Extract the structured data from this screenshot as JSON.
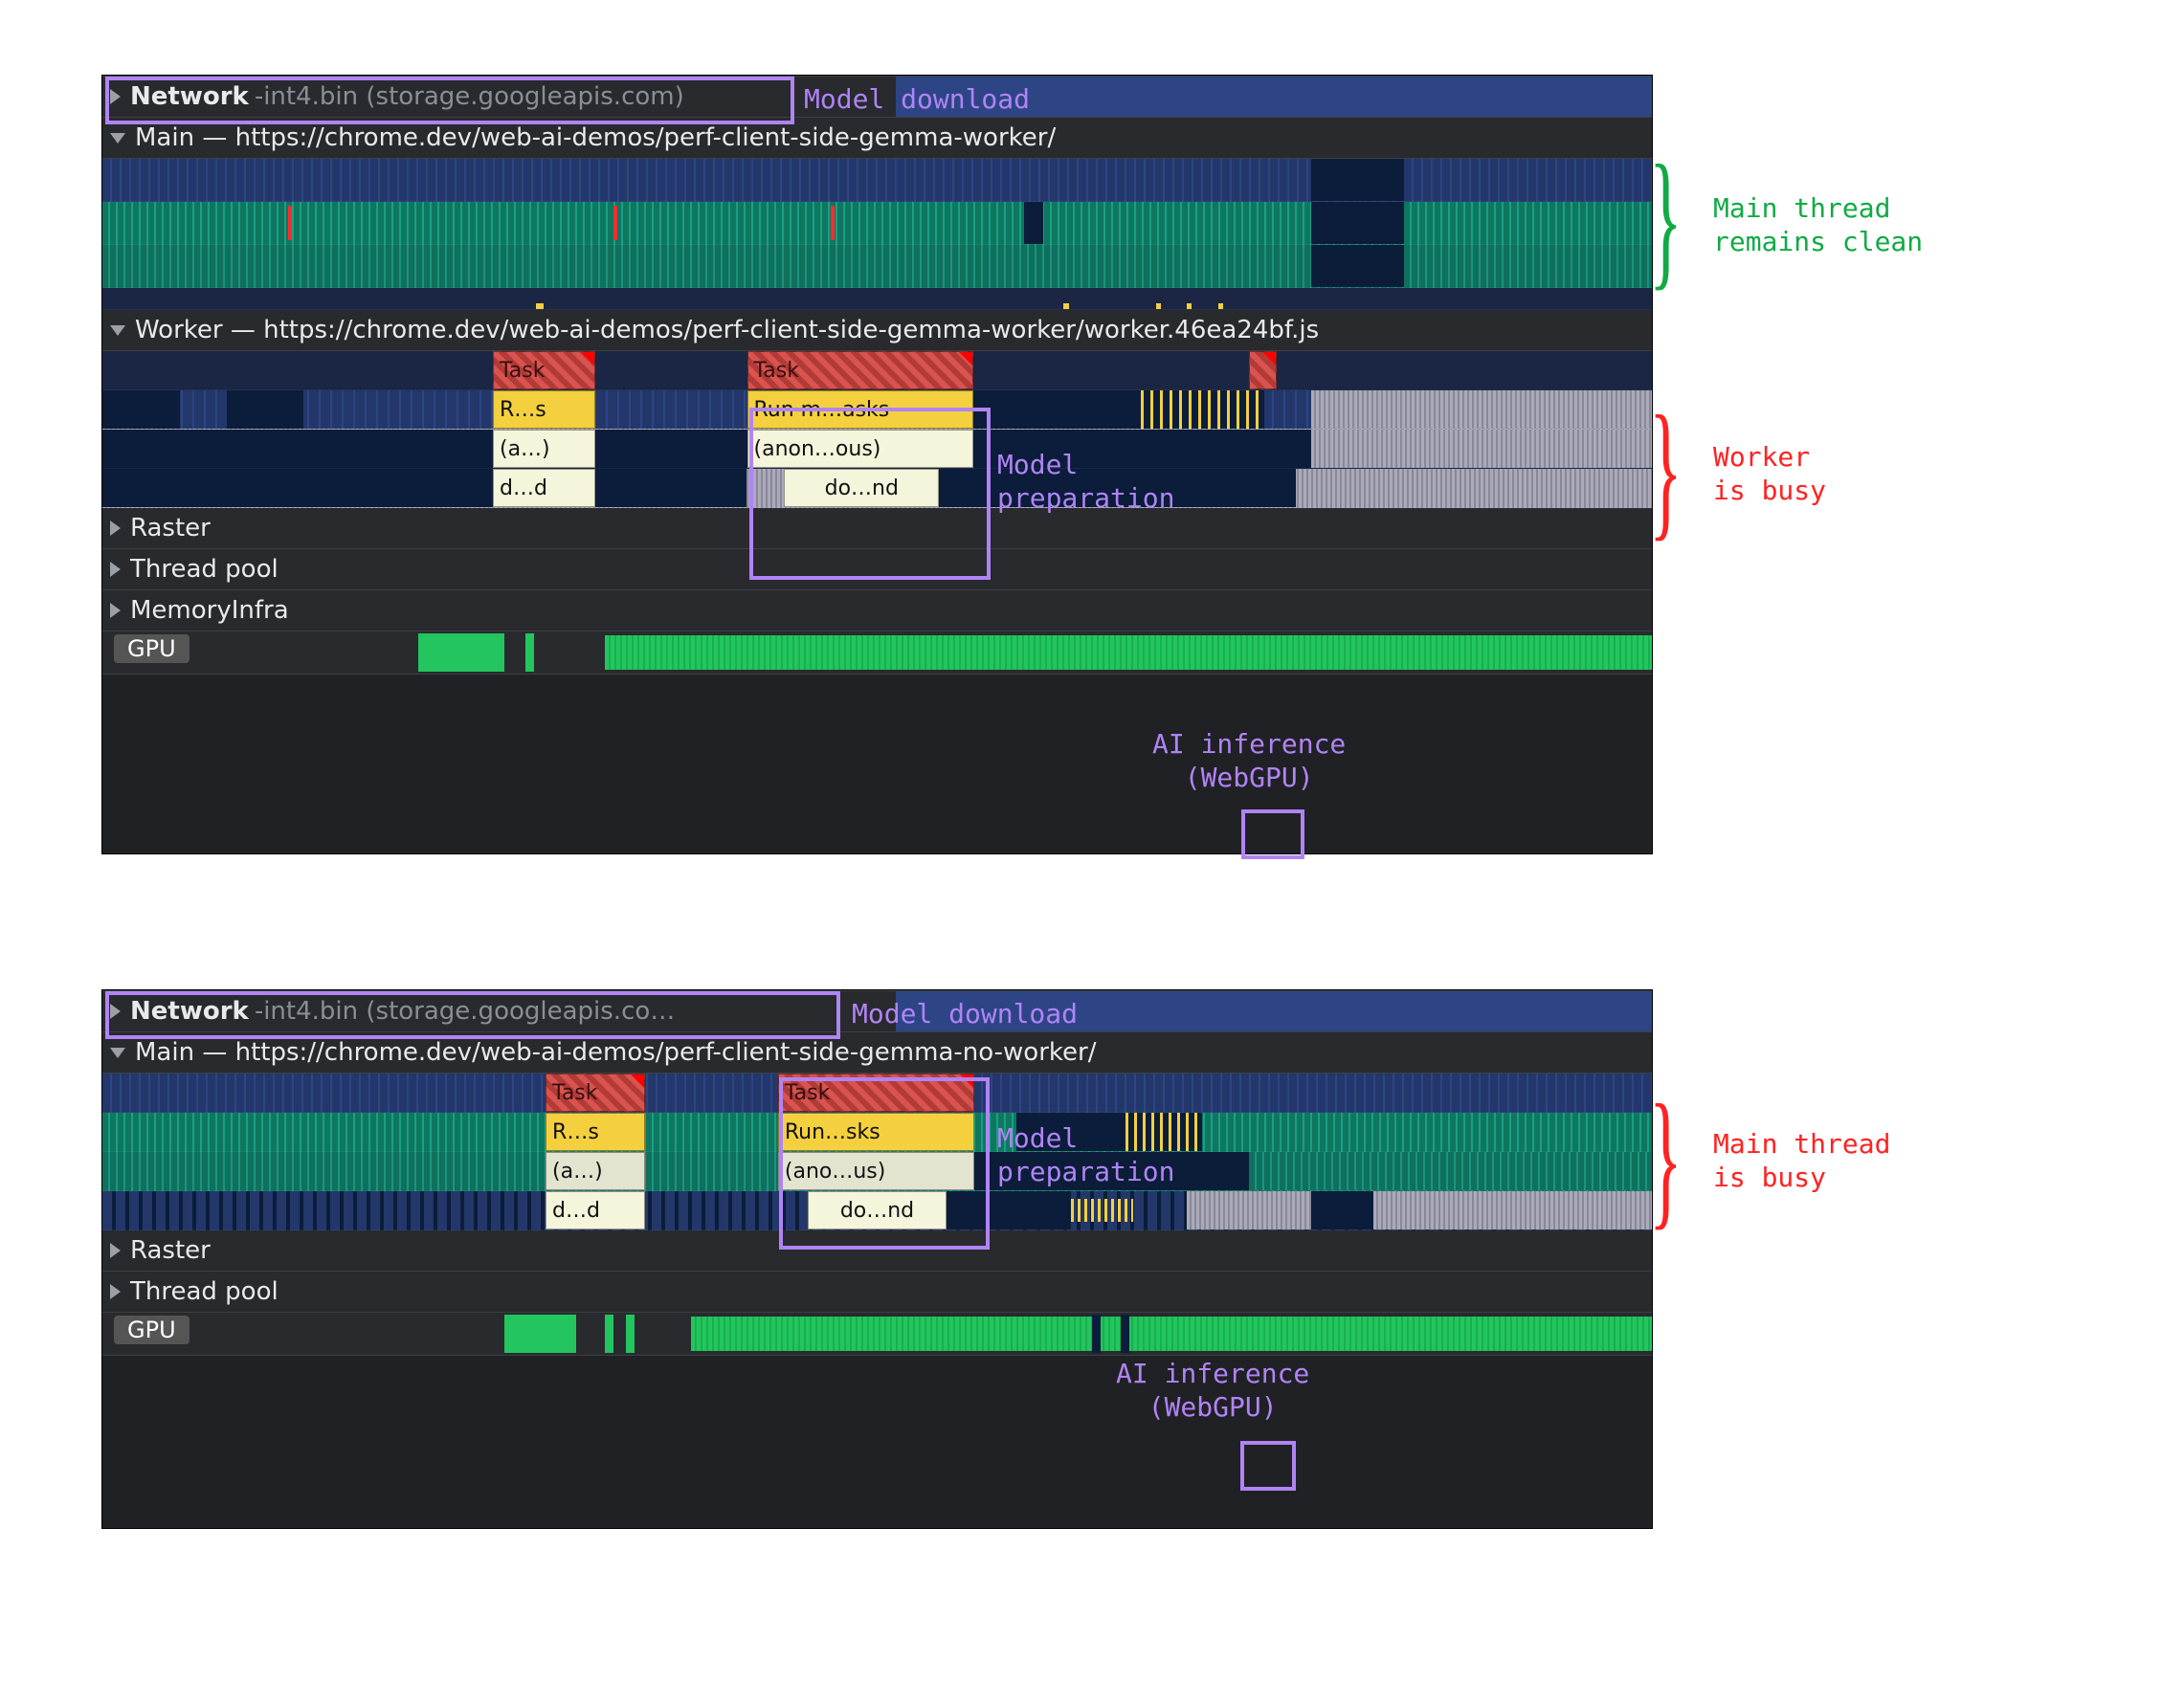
{
  "panels": {
    "top": {
      "network_label": "Network",
      "network_file": "-int4.bin (storage.googleapis.com)",
      "main_label": "Main — https://chrome.dev/web-ai-demos/perf-client-side-gemma-worker/",
      "worker_label": "Worker — https://chrome.dev/web-ai-demos/perf-client-side-gemma-worker/worker.46ea24bf.js",
      "raster_label": "Raster",
      "threadpool_label": "Thread pool",
      "memoryinfra_label": "MemoryInfra",
      "gpu_label": "GPU",
      "tasks": {
        "task1": "Task",
        "task1_rs": "R…s",
        "task1_a": "(a…)",
        "task1_d": "d…d",
        "task2": "Task",
        "task2_run": "Run m…asks",
        "task2_anon": "(anon…ous)",
        "task2_do": "do…nd"
      }
    },
    "bottom": {
      "network_label": "Network",
      "network_file": "-int4.bin (storage.googleapis.co…",
      "main_label": "Main — https://chrome.dev/web-ai-demos/perf-client-side-gemma-no-worker/",
      "raster_label": "Raster",
      "threadpool_label": "Thread pool",
      "gpu_label": "GPU",
      "tasks": {
        "task1": "Task",
        "task1_rs": "R…s",
        "task1_a": "(a…)",
        "task1_d": "d…d",
        "task2": "Task",
        "task2_run": "Run…sks",
        "task2_anon": "(ano…us)",
        "task2_do": "do…nd"
      }
    }
  },
  "annotations": {
    "model_download": "Model download",
    "model_preparation_l1": "Model",
    "model_preparation_l2": "preparation",
    "ai_inference_l1": "AI inference",
    "ai_inference_l2": "(WebGPU)",
    "main_clean_l1": "Main thread",
    "main_clean_l2": "remains clean",
    "worker_busy_l1": "Worker",
    "worker_busy_l2": "is busy",
    "main_busy_l1": "Main thread",
    "main_busy_l2": "is busy"
  }
}
